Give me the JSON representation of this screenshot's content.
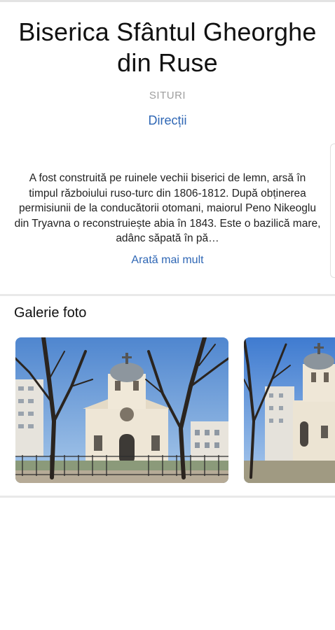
{
  "place": {
    "title": "Biserica Sfântul Gheorghe din Ruse",
    "category": "SITURI",
    "directions_label": "Direcții"
  },
  "description": {
    "text": "A fost construită pe ruinele vechii biserici de lemn, arsă în timpul războiului ruso-turc din 1806-1812. După obținerea permisiunii de la conducătorii otomani, maiorul Peno Nikeoglu din Tryavna o reconstruiește abia în 1843. Este o bazilică mare, adânc săpată în pă…",
    "more_label": "Arată mai mult"
  },
  "gallery": {
    "title": "Galerie foto"
  }
}
